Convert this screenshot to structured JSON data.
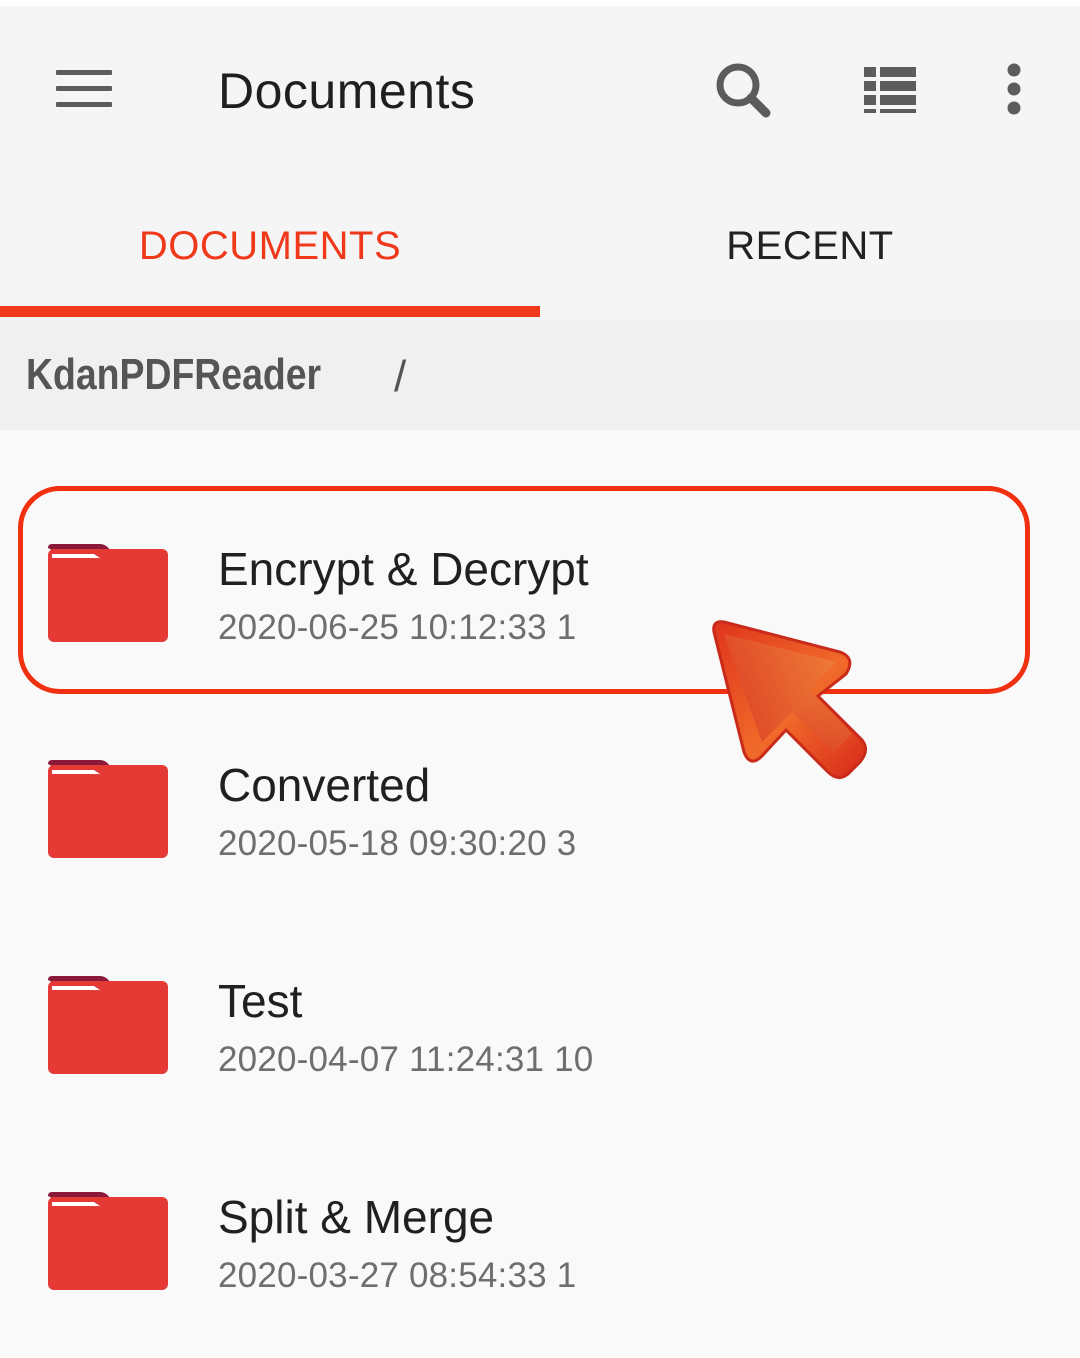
{
  "app_bar": {
    "title": "Documents",
    "icons": [
      "menu-icon",
      "search-icon",
      "list-view-icon",
      "more-vert-icon"
    ]
  },
  "tabs": [
    {
      "label": "DOCUMENTS",
      "active": true
    },
    {
      "label": "RECENT",
      "active": false
    }
  ],
  "breadcrumb": {
    "path": "KdanPDFReader",
    "separator": "/"
  },
  "folders": [
    {
      "name": "Encrypt & Decrypt",
      "date": "2020-06-25 10:12:33",
      "count": "1"
    },
    {
      "name": "Converted",
      "date": "2020-05-18 09:30:20",
      "count": "3"
    },
    {
      "name": "Test",
      "date": "2020-04-07 11:24:31",
      "count": "10"
    },
    {
      "name": "Split & Merge",
      "date": "2020-03-27 08:54:33",
      "count": "1"
    }
  ],
  "colors": {
    "accent": "#f0381a",
    "folder": "#e53935",
    "folder_tab": "#8b1a3a",
    "text_primary": "#202020",
    "text_secondary": "#6e6e6e"
  }
}
